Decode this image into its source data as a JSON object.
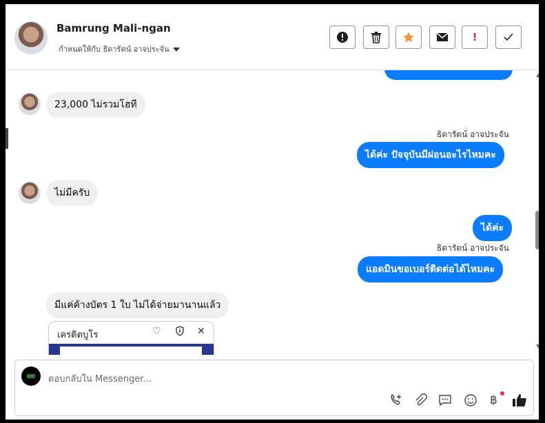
{
  "header": {
    "contact_name": "Bamrung Mali-ngan",
    "assigned_label": "กำหนดให้กับ ธิดารัตน์ อาจประจัน",
    "buttons": [
      "alert-circle-icon",
      "trash-icon",
      "star-icon",
      "envelope-icon",
      "exclamation-icon",
      "check-icon"
    ]
  },
  "messages": [
    {
      "side": "in",
      "text": "23,000 ไม่รวมโฮที"
    },
    {
      "side": "out",
      "sender": "ธิดารัตน์ อาจประจัน",
      "text": "ได้ค่ะ ปัจจุบันมีผ่อนอะไรไหมคะ"
    },
    {
      "side": "in",
      "text": "ไม่มีครับ"
    },
    {
      "side": "out",
      "text": "ได้ค่ะ"
    },
    {
      "side": "out",
      "sender": "ธิดารัตน์ อาจประจัน",
      "text": "แอดมินขอเบอร์ติดต่อได้ไหมคะ"
    },
    {
      "side": "in",
      "text": "มีแค่ค้างบัตร 1 ใบ ไม่ได้จ่ายมานานแล้ว"
    }
  ],
  "card": {
    "title": "เครดิตบูโร"
  },
  "composer": {
    "placeholder": "ตอบกลับใน Messenger...",
    "tools": [
      "phone-plus-icon",
      "paperclip-icon",
      "chat-icon",
      "smiley-icon",
      "baht-icon",
      "thumbs-up-icon"
    ]
  },
  "colors": {
    "accent": "#0a7cff",
    "star": "#f7923a",
    "danger": "#e41e3f"
  }
}
